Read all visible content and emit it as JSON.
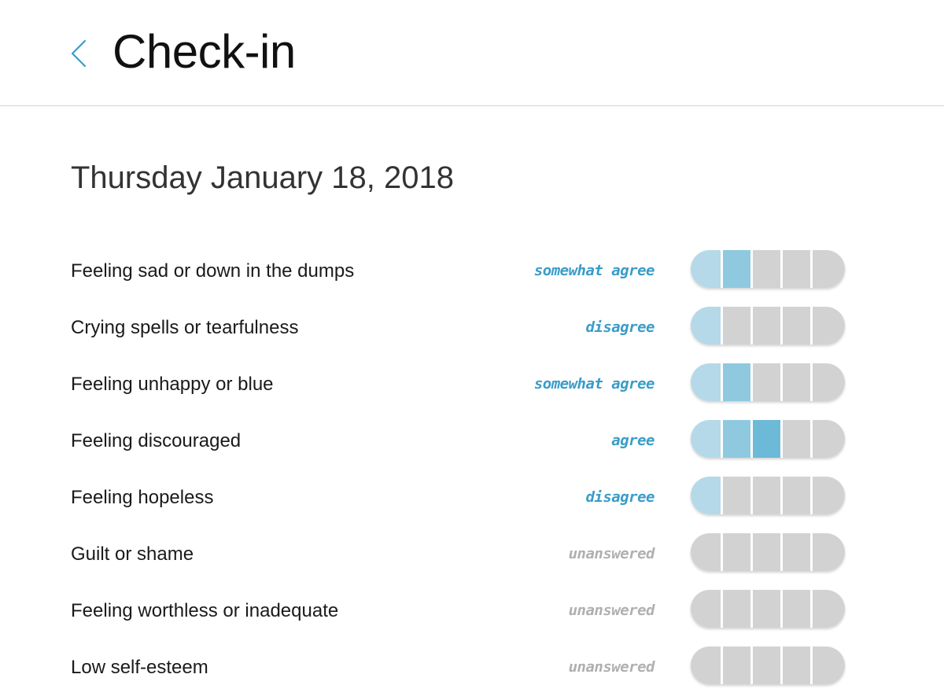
{
  "header": {
    "title": "Check-in",
    "back_icon": "chevron-left-icon",
    "accent_color": "#3a9cc8"
  },
  "date": "Thursday January 18, 2018",
  "scale_steps": 5,
  "items": [
    {
      "label": "Feeling sad or down in the dumps",
      "answer": "somewhat agree",
      "level": 2
    },
    {
      "label": "Crying spells or tearfulness",
      "answer": "disagree",
      "level": 1
    },
    {
      "label": "Feeling unhappy or blue",
      "answer": "somewhat agree",
      "level": 2
    },
    {
      "label": "Feeling discouraged",
      "answer": "agree",
      "level": 3
    },
    {
      "label": "Feeling hopeless",
      "answer": "disagree",
      "level": 1
    },
    {
      "label": "Guilt or shame",
      "answer": "unanswered",
      "level": 0
    },
    {
      "label": "Feeling worthless or inadequate",
      "answer": "unanswered",
      "level": 0
    },
    {
      "label": "Low self-esteem",
      "answer": "unanswered",
      "level": 0
    }
  ]
}
